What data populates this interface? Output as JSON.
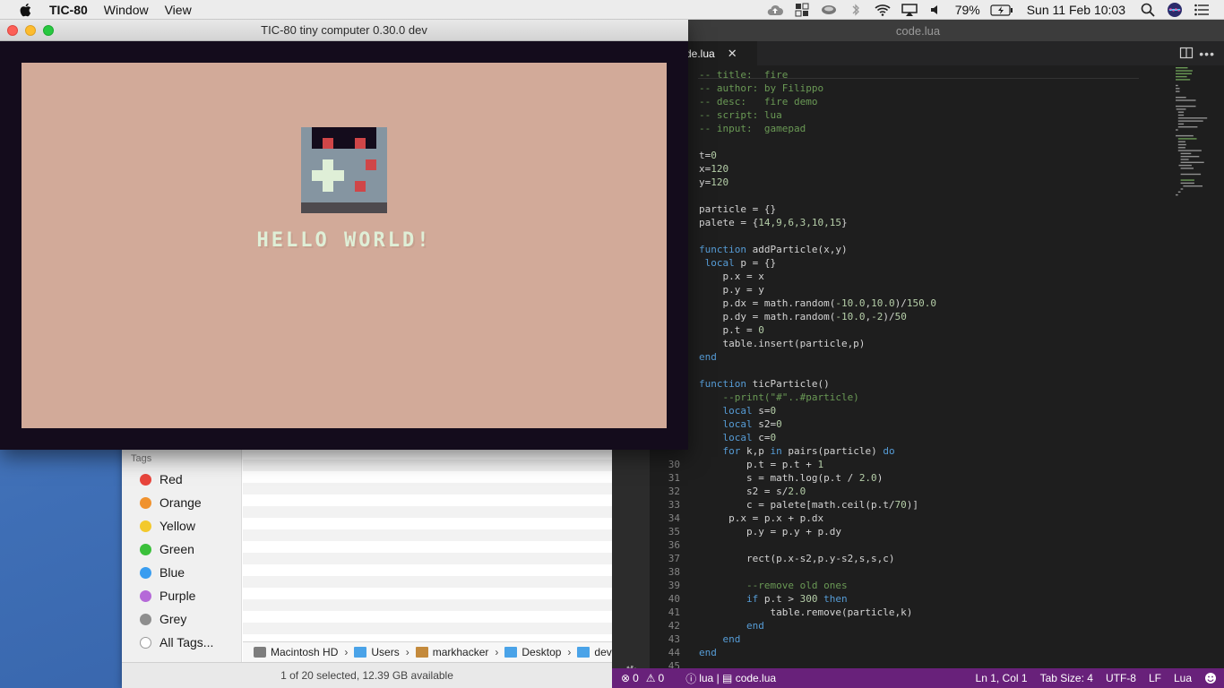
{
  "menubar": {
    "app_name": "TIC-80",
    "menus": [
      "Window",
      "View"
    ],
    "battery": "79%",
    "clock": "Sun 11 Feb  10:03"
  },
  "tic80": {
    "title": "TIC-80 tiny computer 0.30.0 dev",
    "hello_text": "HELLO WORLD!",
    "colors": {
      "screen": "#d2aa99",
      "border": "#140c1c",
      "text": "#dfefd7"
    }
  },
  "vscode": {
    "title": "code.lua",
    "tab_label": "de.lua",
    "code_lines": [
      {
        "n": "",
        "segs": [
          {
            "t": "-- title:  fire",
            "c": "c-com"
          }
        ]
      },
      {
        "n": "",
        "segs": [
          {
            "t": "-- author: by Filippo",
            "c": "c-com"
          }
        ]
      },
      {
        "n": "",
        "segs": [
          {
            "t": "-- desc:   fire demo",
            "c": "c-com"
          }
        ]
      },
      {
        "n": "",
        "segs": [
          {
            "t": "-- script: lua",
            "c": "c-com"
          }
        ]
      },
      {
        "n": "",
        "segs": [
          {
            "t": "-- input:  gamepad",
            "c": "c-com"
          }
        ]
      },
      {
        "n": "",
        "segs": []
      },
      {
        "n": "",
        "segs": [
          {
            "t": "t=",
            "c": ""
          },
          {
            "t": "0",
            "c": "c-num"
          }
        ]
      },
      {
        "n": "",
        "segs": [
          {
            "t": "x=",
            "c": ""
          },
          {
            "t": "120",
            "c": "c-num"
          }
        ]
      },
      {
        "n": "",
        "segs": [
          {
            "t": "y=",
            "c": ""
          },
          {
            "t": "120",
            "c": "c-num"
          }
        ]
      },
      {
        "n": "",
        "segs": []
      },
      {
        "n": "",
        "segs": [
          {
            "t": "particle = {}",
            "c": ""
          }
        ]
      },
      {
        "n": "",
        "segs": [
          {
            "t": "palete = {",
            "c": ""
          },
          {
            "t": "14,9,6,3,10,15",
            "c": "c-num"
          },
          {
            "t": "}",
            "c": ""
          }
        ]
      },
      {
        "n": "",
        "segs": []
      },
      {
        "n": "",
        "segs": [
          {
            "t": "function",
            "c": "c-kw"
          },
          {
            "t": " addParticle(x,y)",
            "c": ""
          }
        ]
      },
      {
        "n": "",
        "segs": [
          {
            "t": " local",
            "c": "c-kw"
          },
          {
            "t": " p = {}",
            "c": ""
          }
        ]
      },
      {
        "n": "",
        "segs": [
          {
            "t": "    p.x = x",
            "c": ""
          }
        ]
      },
      {
        "n": "",
        "segs": [
          {
            "t": "    p.y = y",
            "c": ""
          }
        ]
      },
      {
        "n": "",
        "segs": [
          {
            "t": "    p.dx = math.random(",
            "c": ""
          },
          {
            "t": "-10.0",
            "c": "c-num"
          },
          {
            "t": ",",
            "c": ""
          },
          {
            "t": "10.0",
            "c": "c-num"
          },
          {
            "t": ")/",
            "c": ""
          },
          {
            "t": "150.0",
            "c": "c-num"
          }
        ]
      },
      {
        "n": "",
        "segs": [
          {
            "t": "    p.dy = math.random(",
            "c": ""
          },
          {
            "t": "-10.0",
            "c": "c-num"
          },
          {
            "t": ",",
            "c": ""
          },
          {
            "t": "-2",
            "c": "c-num"
          },
          {
            "t": ")/",
            "c": ""
          },
          {
            "t": "50",
            "c": "c-num"
          }
        ]
      },
      {
        "n": "",
        "segs": [
          {
            "t": "    p.t = ",
            "c": ""
          },
          {
            "t": "0",
            "c": "c-num"
          }
        ]
      },
      {
        "n": "",
        "segs": [
          {
            "t": "    table.insert(particle,p)",
            "c": ""
          }
        ]
      },
      {
        "n": "",
        "segs": [
          {
            "t": "end",
            "c": "c-kw"
          }
        ]
      },
      {
        "n": "",
        "segs": []
      },
      {
        "n": "",
        "segs": [
          {
            "t": "function",
            "c": "c-kw"
          },
          {
            "t": " ticParticle()",
            "c": ""
          }
        ]
      },
      {
        "n": "",
        "segs": [
          {
            "t": "    --print(\"#\"..#particle)",
            "c": "c-com"
          }
        ]
      },
      {
        "n": "",
        "segs": [
          {
            "t": "    local",
            "c": "c-kw"
          },
          {
            "t": " s=",
            "c": ""
          },
          {
            "t": "0",
            "c": "c-num"
          }
        ]
      },
      {
        "n": "",
        "segs": [
          {
            "t": "    local",
            "c": "c-kw"
          },
          {
            "t": " s2=",
            "c": ""
          },
          {
            "t": "0",
            "c": "c-num"
          }
        ]
      },
      {
        "n": "",
        "segs": [
          {
            "t": "    local",
            "c": "c-kw"
          },
          {
            "t": " c=",
            "c": ""
          },
          {
            "t": "0",
            "c": "c-num"
          }
        ]
      },
      {
        "n": "",
        "segs": [
          {
            "t": "    for",
            "c": "c-kw"
          },
          {
            "t": " k,p ",
            "c": ""
          },
          {
            "t": "in",
            "c": "c-kw"
          },
          {
            "t": " pairs(particle) ",
            "c": ""
          },
          {
            "t": "do",
            "c": "c-kw"
          }
        ]
      },
      {
        "n": "30",
        "segs": [
          {
            "t": "        p.t = p.t + ",
            "c": ""
          },
          {
            "t": "1",
            "c": "c-num"
          }
        ]
      },
      {
        "n": "31",
        "segs": [
          {
            "t": "        s = math.log(p.t / ",
            "c": ""
          },
          {
            "t": "2.0",
            "c": "c-num"
          },
          {
            "t": ")",
            "c": ""
          }
        ]
      },
      {
        "n": "32",
        "segs": [
          {
            "t": "        s2 = s/",
            "c": ""
          },
          {
            "t": "2.0",
            "c": "c-num"
          }
        ]
      },
      {
        "n": "33",
        "segs": [
          {
            "t": "        c = palete[math.ceil(p.t/",
            "c": ""
          },
          {
            "t": "70",
            "c": "c-num"
          },
          {
            "t": ")]",
            "c": ""
          }
        ]
      },
      {
        "n": "34",
        "segs": [
          {
            "t": "     p.x = p.x + p.dx",
            "c": ""
          }
        ]
      },
      {
        "n": "35",
        "segs": [
          {
            "t": "        p.y = p.y + p.dy",
            "c": ""
          }
        ]
      },
      {
        "n": "36",
        "segs": []
      },
      {
        "n": "37",
        "segs": [
          {
            "t": "        rect(p.x-s2,p.y-s2,s,s,c)",
            "c": ""
          }
        ]
      },
      {
        "n": "38",
        "segs": []
      },
      {
        "n": "39",
        "segs": [
          {
            "t": "        --remove old ones",
            "c": "c-com"
          }
        ]
      },
      {
        "n": "40",
        "segs": [
          {
            "t": "        if",
            "c": "c-kw"
          },
          {
            "t": " p.t > ",
            "c": ""
          },
          {
            "t": "300",
            "c": "c-num"
          },
          {
            "t": " then",
            "c": "c-kw"
          }
        ]
      },
      {
        "n": "41",
        "segs": [
          {
            "t": "            table.remove(particle,k)",
            "c": ""
          }
        ]
      },
      {
        "n": "42",
        "segs": [
          {
            "t": "        end",
            "c": "c-kw"
          }
        ]
      },
      {
        "n": "43",
        "segs": [
          {
            "t": "    end",
            "c": "c-kw"
          }
        ]
      },
      {
        "n": "44",
        "segs": [
          {
            "t": "end",
            "c": "c-kw"
          }
        ]
      },
      {
        "n": "45",
        "segs": []
      }
    ],
    "status": {
      "errors": "0",
      "warnings": "0",
      "file": "lua | \u0001 code.lua",
      "position": "Ln 1, Col 1",
      "tab_size": "Tab Size: 4",
      "encoding": "UTF-8",
      "eol": "LF",
      "language": "Lua"
    }
  },
  "finder": {
    "tags_heading": "Tags",
    "tags": [
      {
        "label": "Red",
        "color": "#e8453c"
      },
      {
        "label": "Orange",
        "color": "#f0922e"
      },
      {
        "label": "Yellow",
        "color": "#f3c92d"
      },
      {
        "label": "Green",
        "color": "#3bc03b"
      },
      {
        "label": "Blue",
        "color": "#3a9df0"
      },
      {
        "label": "Purple",
        "color": "#b569d8"
      },
      {
        "label": "Grey",
        "color": "#8e8e8e"
      },
      {
        "label": "All Tags...",
        "color": ""
      }
    ],
    "path": [
      "Macintosh HD",
      "Users",
      "markhacker",
      "Desktop",
      "dev"
    ],
    "status": "1 of 20 selected, 12.39 GB available"
  }
}
